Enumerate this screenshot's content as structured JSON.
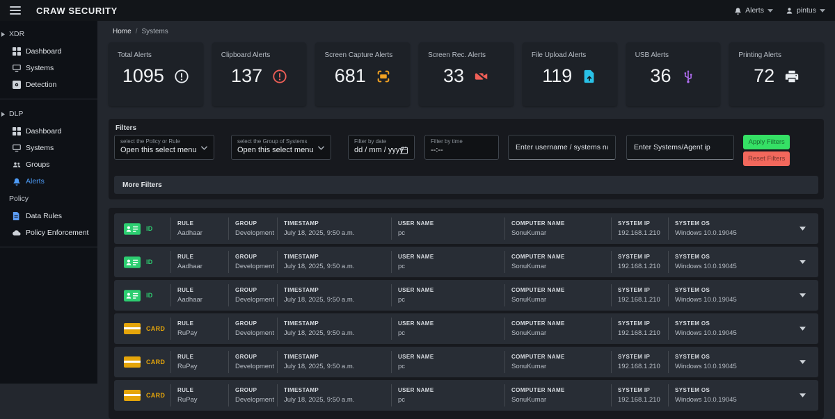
{
  "topbar": {
    "brand": "CRAW SECURITY",
    "alerts_label": "Alerts",
    "user_label": "pintus"
  },
  "breadcrumb": {
    "home": "Home",
    "separator": "/",
    "current": "Systems"
  },
  "sidebar": {
    "sections": [
      {
        "title": "XDR",
        "items": [
          {
            "label": "Dashboard"
          },
          {
            "label": "Systems"
          },
          {
            "label": "Detection"
          }
        ]
      },
      {
        "title": "DLP",
        "items": [
          {
            "label": "Dashboard"
          },
          {
            "label": "Systems"
          },
          {
            "label": "Groups"
          },
          {
            "label": "Alerts"
          }
        ]
      },
      {
        "title": "Policy",
        "items": [
          {
            "label": "Data Rules"
          },
          {
            "label": "Policy Enforcement"
          }
        ]
      }
    ]
  },
  "cards": [
    {
      "label": "Total Alerts",
      "value": "1095",
      "icon": "exclamation-circle-icon"
    },
    {
      "label": "Clipboard Alerts",
      "value": "137",
      "icon": "exclamation-circle-icon"
    },
    {
      "label": "Screen Capture Alerts",
      "value": "681",
      "icon": "screen-capture-icon"
    },
    {
      "label": "Screen Rec. Alerts",
      "value": "33",
      "icon": "video-slash-icon"
    },
    {
      "label": "File Upload Alerts",
      "value": "119",
      "icon": "file-upload-icon"
    },
    {
      "label": "USB Alerts",
      "value": "36",
      "icon": "usb-icon"
    },
    {
      "label": "Printing Alerts",
      "value": "72",
      "icon": "printer-icon"
    }
  ],
  "filters": {
    "title": "Filters",
    "policy_select": {
      "label": "select the Policy or Rule",
      "value": "Open this select menu"
    },
    "group_select": {
      "label": "select the Group of Systems",
      "value": "Open this select menu"
    },
    "date": {
      "label": "Filter by date",
      "value": "dd / mm / yyyy"
    },
    "time": {
      "label": "Filter by time",
      "value": "--:--"
    },
    "username_placeholder": "Enter username / systems name",
    "agent_ip_placeholder": "Enter Systems/Agent ip",
    "apply_label": "Apply Filters",
    "reset_label": "Reset Filters",
    "more_label": "More Filters"
  },
  "table": {
    "columns": [
      "RULE",
      "GROUP",
      "TIMESTAMP",
      "USER NAME",
      "COMPUTER NAME",
      "SYSTEM IP",
      "SYSTEM OS"
    ],
    "rows": [
      {
        "type": "ID",
        "rule": "Aadhaar",
        "group": "Development",
        "timestamp": "July 18, 2025, 9:50 a.m.",
        "user_name": "pc",
        "computer_name": "SonuKumar",
        "system_ip": "192.168.1.210",
        "system_os": "Windows 10.0.19045"
      },
      {
        "type": "ID",
        "rule": "Aadhaar",
        "group": "Development",
        "timestamp": "July 18, 2025, 9:50 a.m.",
        "user_name": "pc",
        "computer_name": "SonuKumar",
        "system_ip": "192.168.1.210",
        "system_os": "Windows 10.0.19045"
      },
      {
        "type": "ID",
        "rule": "Aadhaar",
        "group": "Development",
        "timestamp": "July 18, 2025, 9:50 a.m.",
        "user_name": "pc",
        "computer_name": "SonuKumar",
        "system_ip": "192.168.1.210",
        "system_os": "Windows 10.0.19045"
      },
      {
        "type": "CARD",
        "rule": "RuPay",
        "group": "Development",
        "timestamp": "July 18, 2025, 9:50 a.m.",
        "user_name": "pc",
        "computer_name": "SonuKumar",
        "system_ip": "192.168.1.210",
        "system_os": "Windows 10.0.19045"
      },
      {
        "type": "CARD",
        "rule": "RuPay",
        "group": "Development",
        "timestamp": "July 18, 2025, 9:50 a.m.",
        "user_name": "pc",
        "computer_name": "SonuKumar",
        "system_ip": "192.168.1.210",
        "system_os": "Windows 10.0.19045"
      },
      {
        "type": "CARD",
        "rule": "RuPay",
        "group": "Development",
        "timestamp": "July 18, 2025, 9:50 a.m.",
        "user_name": "pc",
        "computer_name": "SonuKumar",
        "system_ip": "192.168.1.210",
        "system_os": "Windows 10.0.19045"
      }
    ]
  },
  "colors": {
    "accent_blue": "#4d9cf8",
    "id_green": "#2dce71",
    "card_yellow": "#e5a50a",
    "capture_orange": "#f5a322",
    "alert_red": "#f05f57",
    "file_cyan": "#29c2e8",
    "usb_purple": "#b16ef2",
    "apply_green": "#35e065",
    "reset_red": "#f2685c"
  }
}
